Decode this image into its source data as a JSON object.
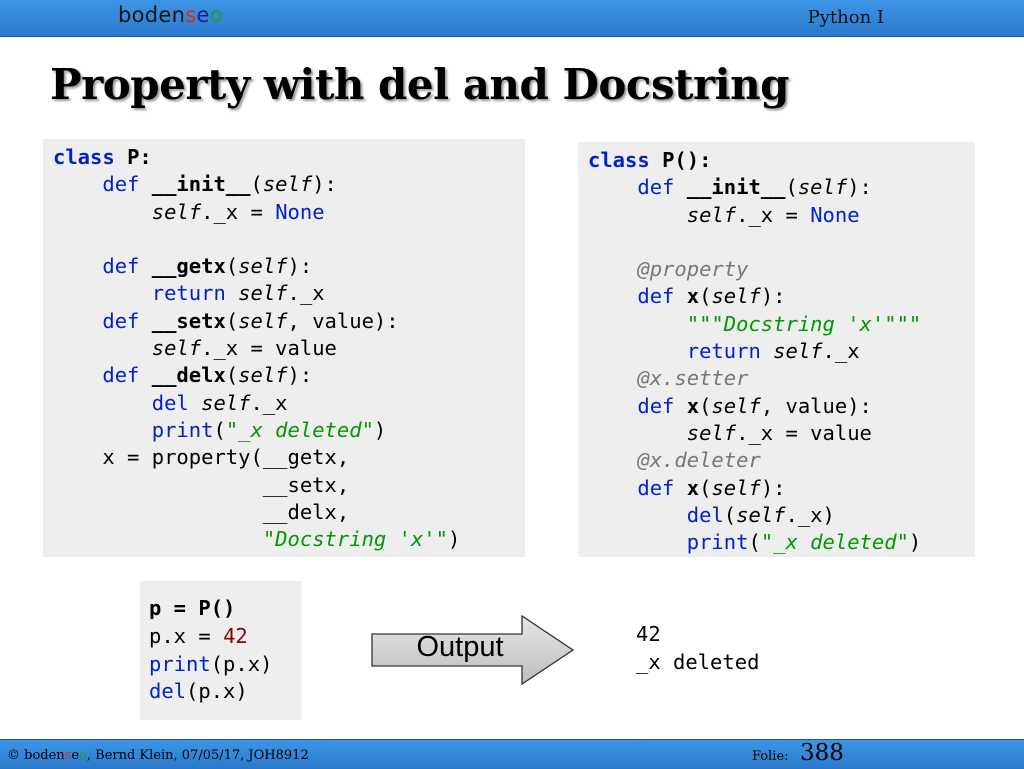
{
  "header": {
    "logo_parts": [
      "boden",
      "s",
      "e",
      "o"
    ],
    "course": "Python I"
  },
  "title": "Property with del and Docstring",
  "code_left": {
    "l1": [
      "class ",
      "P",
      ":"
    ],
    "l2": [
      "    ",
      "def ",
      "__init__",
      "(",
      "self",
      "):"
    ],
    "l3": [
      "        ",
      "self",
      "._x = ",
      "None"
    ],
    "l4": [
      ""
    ],
    "l5": [
      "    ",
      "def ",
      "__getx",
      "(",
      "self",
      "):"
    ],
    "l6": [
      "        ",
      "return ",
      "self",
      "._x"
    ],
    "l7": [
      "    ",
      "def ",
      "__setx",
      "(",
      "self",
      ", value):"
    ],
    "l8": [
      "        ",
      "self",
      "._x = value"
    ],
    "l9": [
      "    ",
      "def ",
      "__delx",
      "(",
      "self",
      "):"
    ],
    "l10": [
      "        ",
      "del ",
      "self",
      "._x"
    ],
    "l11": [
      "        ",
      "print",
      "(",
      "\"_x deleted\"",
      ")"
    ],
    "l12": [
      "    x = property(__getx,"
    ],
    "l13": [
      "                 __setx,"
    ],
    "l14": [
      "                 __delx,"
    ],
    "l15": [
      "                 ",
      "\"Docstring 'x'\"",
      ")"
    ]
  },
  "code_right": {
    "l1": [
      "class ",
      "P():"
    ],
    "l2": [
      "    ",
      "def ",
      "__init__",
      "(",
      "self",
      "):"
    ],
    "l3": [
      "        ",
      "self",
      "._x = ",
      "None"
    ],
    "l4": [
      ""
    ],
    "l5": [
      "    ",
      "@property"
    ],
    "l6": [
      "    ",
      "def ",
      "x",
      "(",
      "self",
      "):"
    ],
    "l7": [
      "        ",
      "\"\"\"Docstring 'x'\"\"\""
    ],
    "l8": [
      "        ",
      "return ",
      "self",
      "._x"
    ],
    "l9": [
      "    ",
      "@x.setter"
    ],
    "l10": [
      "    ",
      "def ",
      "x",
      "(",
      "self",
      ", value):"
    ],
    "l11": [
      "        ",
      "self",
      "._x = value"
    ],
    "l12": [
      "    ",
      "@x.deleter"
    ],
    "l13": [
      "    ",
      "def ",
      "x",
      "(",
      "self",
      "):"
    ],
    "l14": [
      "        ",
      "del",
      "(",
      "self",
      "._x)"
    ],
    "l15": [
      "        ",
      "print",
      "(",
      "\"_x deleted\"",
      ")"
    ]
  },
  "code_usage": {
    "l1": "p = P()",
    "l2": [
      "p.x = ",
      "42"
    ],
    "l3": [
      "print",
      "(p.x)"
    ],
    "l4": [
      "del",
      "(p.x)"
    ]
  },
  "output": {
    "label": "Output",
    "line1": "42",
    "line2": "_x deleted"
  },
  "footer": {
    "copyright_prefix": "© boden",
    "brand_s": "s",
    "brand_e": "e",
    "brand_o": "o",
    "credit": ", Bernd Klein, 07/05/17, JOH8912",
    "folie_label": "Folie:",
    "folie_number": "388"
  },
  "colors": {
    "bar_blue": "#2a79cc",
    "keyword": "#0022cc",
    "string": "#009900",
    "decorator": "#777777",
    "number": "#8b0000",
    "code_bg": "#eeeeee"
  }
}
